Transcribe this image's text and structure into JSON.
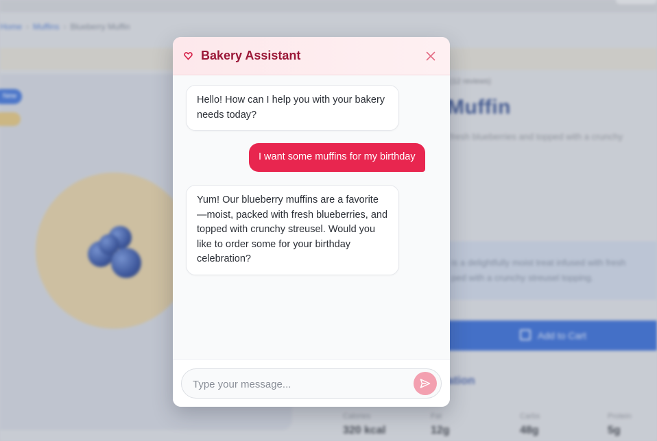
{
  "background": {
    "breadcrumb": [
      "Home",
      "Muffins",
      "Blueberry Muffin"
    ],
    "badge": "New",
    "reviews": "(12 reviews)",
    "product_title": "Muffin",
    "product_desc": "fresh blueberries and topped with a crunchy",
    "info_lines": [
      "is a delightfully moist treat infused with fresh",
      "ped with a crunchy streusel topping."
    ],
    "add_to_cart": "Add to Cart",
    "nutrition_title": "ation",
    "nutrition": [
      {
        "label": "Calories",
        "value": "320 kcal"
      },
      {
        "label": "Fat",
        "value": "12g"
      },
      {
        "label": "Carbs",
        "value": "48g"
      },
      {
        "label": "Protein",
        "value": "5g"
      }
    ]
  },
  "chat": {
    "title": "Bakery Assistant",
    "icons": {
      "logo": "heart-icon",
      "close": "close-icon",
      "send": "send-icon"
    },
    "colors": {
      "accent": "#e8264f",
      "title": "#9b1838",
      "send_button": "#f3a0b0"
    },
    "messages": [
      {
        "role": "bot",
        "text": "Hello! How can I help you with your bakery needs today?"
      },
      {
        "role": "user",
        "text": "I want some muffins for my birthday"
      },
      {
        "role": "bot",
        "text": "Yum! Our blueberry muffins are a favorite—moist, packed with fresh blueberries, and topped with crunchy streusel. Would you like to order some for your birthday celebration?"
      }
    ],
    "input": {
      "placeholder": "Type your message...",
      "value": ""
    }
  }
}
